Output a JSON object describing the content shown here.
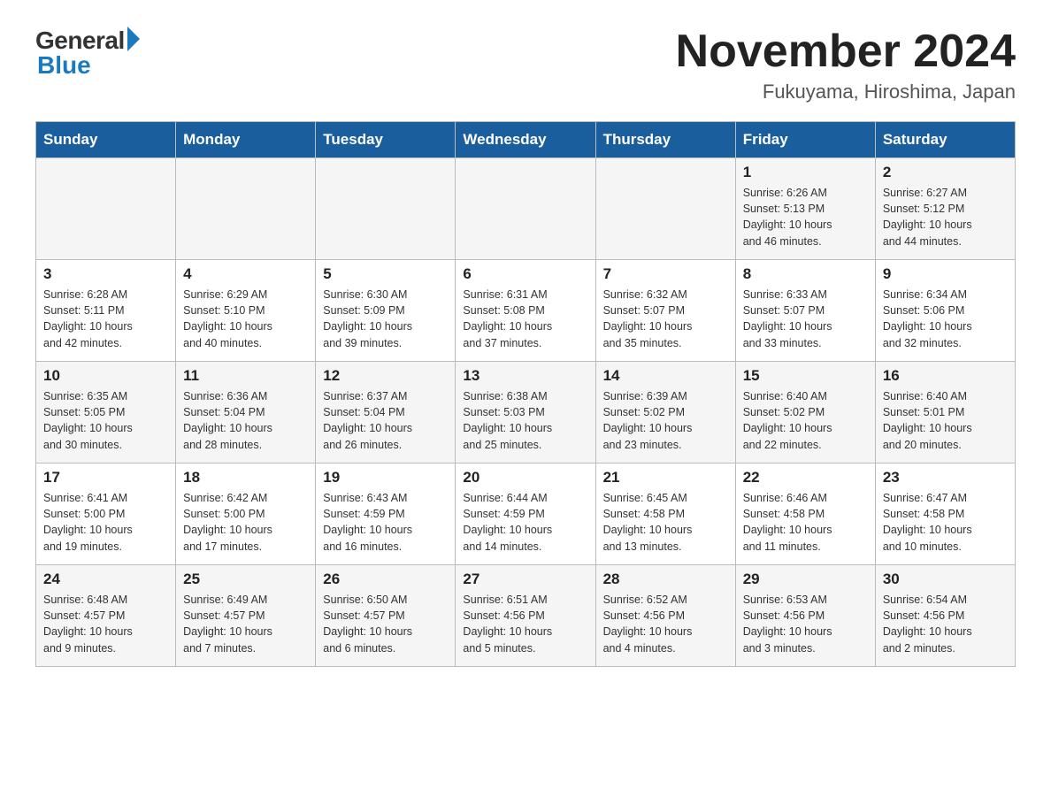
{
  "logo": {
    "general": "General",
    "blue": "Blue"
  },
  "title": {
    "month": "November 2024",
    "location": "Fukuyama, Hiroshima, Japan"
  },
  "days_of_week": [
    "Sunday",
    "Monday",
    "Tuesday",
    "Wednesday",
    "Thursday",
    "Friday",
    "Saturday"
  ],
  "weeks": [
    {
      "days": [
        {
          "num": "",
          "info": ""
        },
        {
          "num": "",
          "info": ""
        },
        {
          "num": "",
          "info": ""
        },
        {
          "num": "",
          "info": ""
        },
        {
          "num": "",
          "info": ""
        },
        {
          "num": "1",
          "info": "Sunrise: 6:26 AM\nSunset: 5:13 PM\nDaylight: 10 hours\nand 46 minutes."
        },
        {
          "num": "2",
          "info": "Sunrise: 6:27 AM\nSunset: 5:12 PM\nDaylight: 10 hours\nand 44 minutes."
        }
      ]
    },
    {
      "days": [
        {
          "num": "3",
          "info": "Sunrise: 6:28 AM\nSunset: 5:11 PM\nDaylight: 10 hours\nand 42 minutes."
        },
        {
          "num": "4",
          "info": "Sunrise: 6:29 AM\nSunset: 5:10 PM\nDaylight: 10 hours\nand 40 minutes."
        },
        {
          "num": "5",
          "info": "Sunrise: 6:30 AM\nSunset: 5:09 PM\nDaylight: 10 hours\nand 39 minutes."
        },
        {
          "num": "6",
          "info": "Sunrise: 6:31 AM\nSunset: 5:08 PM\nDaylight: 10 hours\nand 37 minutes."
        },
        {
          "num": "7",
          "info": "Sunrise: 6:32 AM\nSunset: 5:07 PM\nDaylight: 10 hours\nand 35 minutes."
        },
        {
          "num": "8",
          "info": "Sunrise: 6:33 AM\nSunset: 5:07 PM\nDaylight: 10 hours\nand 33 minutes."
        },
        {
          "num": "9",
          "info": "Sunrise: 6:34 AM\nSunset: 5:06 PM\nDaylight: 10 hours\nand 32 minutes."
        }
      ]
    },
    {
      "days": [
        {
          "num": "10",
          "info": "Sunrise: 6:35 AM\nSunset: 5:05 PM\nDaylight: 10 hours\nand 30 minutes."
        },
        {
          "num": "11",
          "info": "Sunrise: 6:36 AM\nSunset: 5:04 PM\nDaylight: 10 hours\nand 28 minutes."
        },
        {
          "num": "12",
          "info": "Sunrise: 6:37 AM\nSunset: 5:04 PM\nDaylight: 10 hours\nand 26 minutes."
        },
        {
          "num": "13",
          "info": "Sunrise: 6:38 AM\nSunset: 5:03 PM\nDaylight: 10 hours\nand 25 minutes."
        },
        {
          "num": "14",
          "info": "Sunrise: 6:39 AM\nSunset: 5:02 PM\nDaylight: 10 hours\nand 23 minutes."
        },
        {
          "num": "15",
          "info": "Sunrise: 6:40 AM\nSunset: 5:02 PM\nDaylight: 10 hours\nand 22 minutes."
        },
        {
          "num": "16",
          "info": "Sunrise: 6:40 AM\nSunset: 5:01 PM\nDaylight: 10 hours\nand 20 minutes."
        }
      ]
    },
    {
      "days": [
        {
          "num": "17",
          "info": "Sunrise: 6:41 AM\nSunset: 5:00 PM\nDaylight: 10 hours\nand 19 minutes."
        },
        {
          "num": "18",
          "info": "Sunrise: 6:42 AM\nSunset: 5:00 PM\nDaylight: 10 hours\nand 17 minutes."
        },
        {
          "num": "19",
          "info": "Sunrise: 6:43 AM\nSunset: 4:59 PM\nDaylight: 10 hours\nand 16 minutes."
        },
        {
          "num": "20",
          "info": "Sunrise: 6:44 AM\nSunset: 4:59 PM\nDaylight: 10 hours\nand 14 minutes."
        },
        {
          "num": "21",
          "info": "Sunrise: 6:45 AM\nSunset: 4:58 PM\nDaylight: 10 hours\nand 13 minutes."
        },
        {
          "num": "22",
          "info": "Sunrise: 6:46 AM\nSunset: 4:58 PM\nDaylight: 10 hours\nand 11 minutes."
        },
        {
          "num": "23",
          "info": "Sunrise: 6:47 AM\nSunset: 4:58 PM\nDaylight: 10 hours\nand 10 minutes."
        }
      ]
    },
    {
      "days": [
        {
          "num": "24",
          "info": "Sunrise: 6:48 AM\nSunset: 4:57 PM\nDaylight: 10 hours\nand 9 minutes."
        },
        {
          "num": "25",
          "info": "Sunrise: 6:49 AM\nSunset: 4:57 PM\nDaylight: 10 hours\nand 7 minutes."
        },
        {
          "num": "26",
          "info": "Sunrise: 6:50 AM\nSunset: 4:57 PM\nDaylight: 10 hours\nand 6 minutes."
        },
        {
          "num": "27",
          "info": "Sunrise: 6:51 AM\nSunset: 4:56 PM\nDaylight: 10 hours\nand 5 minutes."
        },
        {
          "num": "28",
          "info": "Sunrise: 6:52 AM\nSunset: 4:56 PM\nDaylight: 10 hours\nand 4 minutes."
        },
        {
          "num": "29",
          "info": "Sunrise: 6:53 AM\nSunset: 4:56 PM\nDaylight: 10 hours\nand 3 minutes."
        },
        {
          "num": "30",
          "info": "Sunrise: 6:54 AM\nSunset: 4:56 PM\nDaylight: 10 hours\nand 2 minutes."
        }
      ]
    }
  ]
}
